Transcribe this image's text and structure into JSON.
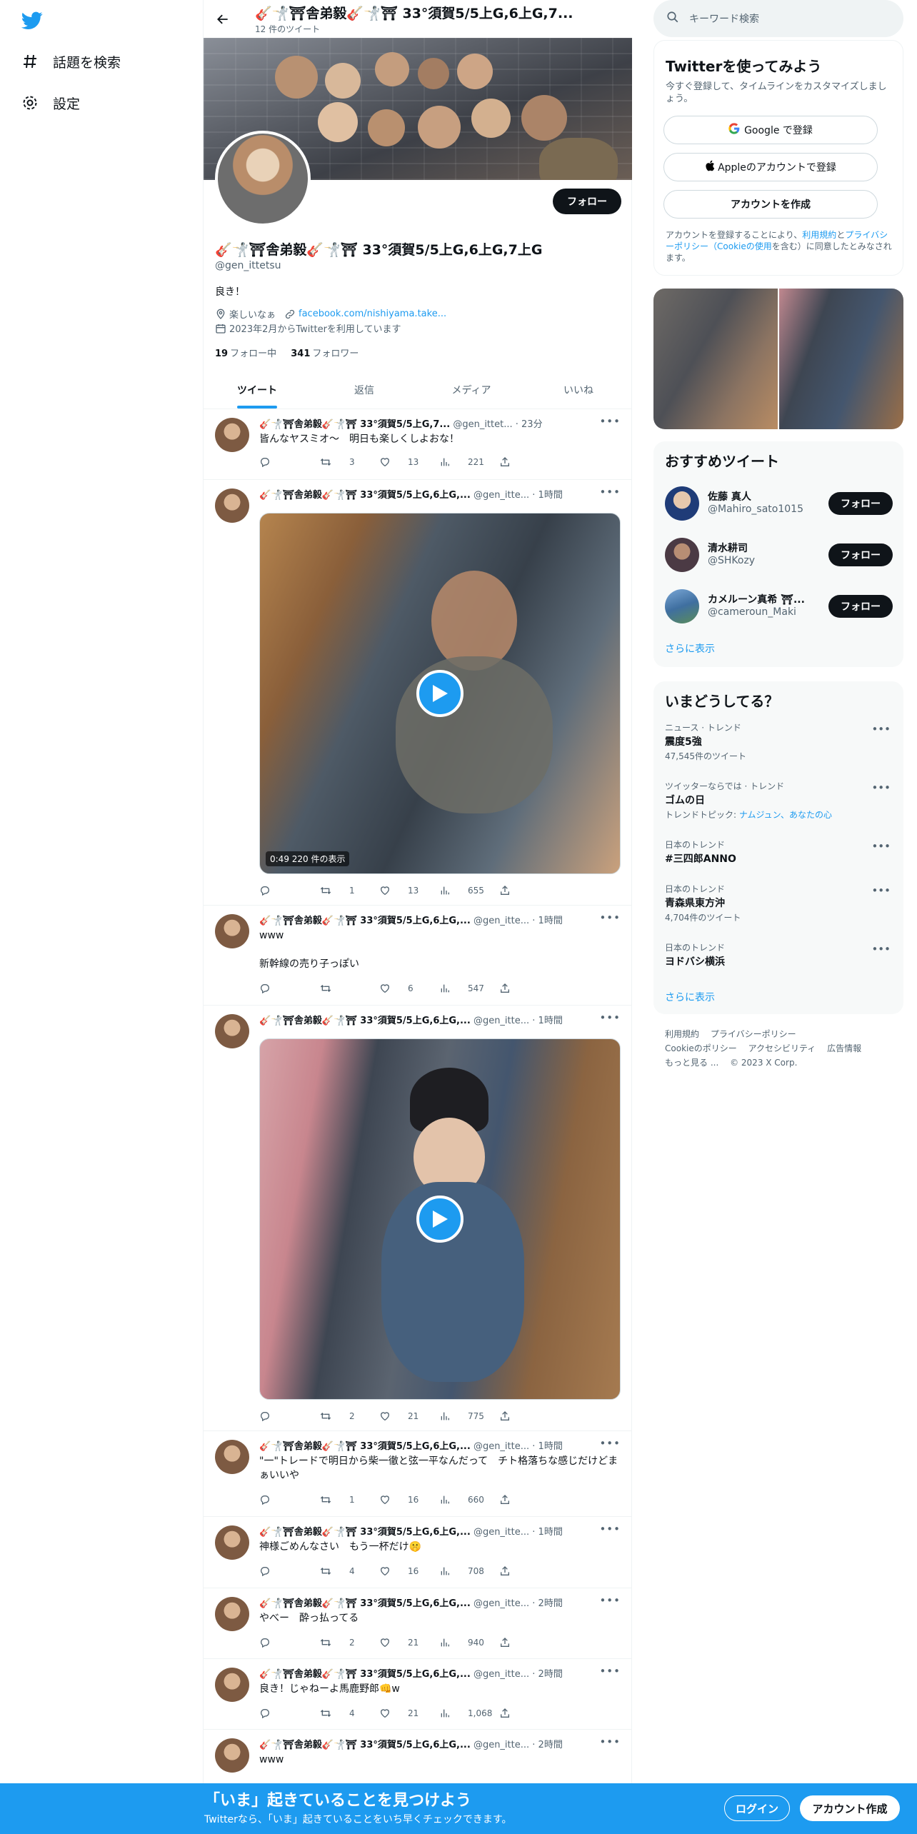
{
  "nav": {
    "explore_label": "話題を検索",
    "settings_label": "設定"
  },
  "header": {
    "name": "🎸🤺⛩舎弟毅🎸🤺⛩ 33°須賀5/5上G,6上G,7...",
    "tweet_count": "12 件のツイート"
  },
  "profile": {
    "follow_label": "フォロー",
    "name": "🎸🤺⛩舎弟毅🎸🤺⛩ 33°須賀5/5上G,6上G,7上G",
    "handle": "@gen_ittetsu",
    "bio": "良き！",
    "location": "楽しいなぁ",
    "url": "facebook.com/nishiyama.take...",
    "joined": "2023年2月からTwitterを利用しています",
    "following_count": "19",
    "following_label": "フォロー中",
    "followers_count": "341",
    "followers_label": "フォロワー"
  },
  "tabs": [
    "ツイート",
    "返信",
    "メディア",
    "いいね"
  ],
  "tweets": [
    {
      "name": "🎸🤺⛩舎弟毅🎸🤺⛩ 33°須賀5/5上G,7...",
      "handle": "@gen_ittet...",
      "time": "· 23分",
      "text": "皆んなヤスミオ〜　明日も楽しくしよおな！",
      "reply": "",
      "retweet": "3",
      "like": "13",
      "views": "221"
    },
    {
      "name": "🎸🤺⛩舎弟毅🎸🤺⛩ 33°須賀5/5上G,6上G,...",
      "handle": "@gen_itte...",
      "time": "· 1時間",
      "text": "",
      "video_info": "0:49   220 件の表示",
      "reply": "",
      "retweet": "1",
      "like": "13",
      "views": "655"
    },
    {
      "name": "🎸🤺⛩舎弟毅🎸🤺⛩ 33°須賀5/5上G,6上G,...",
      "handle": "@gen_itte...",
      "time": "· 1時間",
      "text": "www\n\n新幹線の売り子っぽい",
      "reply": "",
      "retweet": "",
      "like": "6",
      "views": "547"
    },
    {
      "name": "🎸🤺⛩舎弟毅🎸🤺⛩ 33°須賀5/5上G,6上G,...",
      "handle": "@gen_itte...",
      "time": "· 1時間",
      "text": "",
      "reply": "",
      "retweet": "2",
      "like": "21",
      "views": "775"
    },
    {
      "name": "🎸🤺⛩舎弟毅🎸🤺⛩ 33°須賀5/5上G,6上G,...",
      "handle": "@gen_itte...",
      "time": "· 1時間",
      "text": "\"一\"トレードで明日から柴一徹と弦一平なんだって　チト格落ちな感じだけどまぁいいや",
      "reply": "",
      "retweet": "1",
      "like": "16",
      "views": "660"
    },
    {
      "name": "🎸🤺⛩舎弟毅🎸🤺⛩ 33°須賀5/5上G,6上G,...",
      "handle": "@gen_itte...",
      "time": "· 1時間",
      "text": "神様ごめんなさい　もう一杯だけ🤫",
      "reply": "",
      "retweet": "4",
      "like": "16",
      "views": "708"
    },
    {
      "name": "🎸🤺⛩舎弟毅🎸🤺⛩ 33°須賀5/5上G,6上G,...",
      "handle": "@gen_itte...",
      "time": "· 2時間",
      "text": "やべー　酔っ払ってる",
      "reply": "",
      "retweet": "2",
      "like": "21",
      "views": "940"
    },
    {
      "name": "🎸🤺⛩舎弟毅🎸🤺⛩ 33°須賀5/5上G,6上G,...",
      "handle": "@gen_itte...",
      "time": "· 2時間",
      "text": "良き！じゃねーよ馬鹿野郎👊w",
      "reply": "",
      "retweet": "4",
      "like": "21",
      "views": "1,068"
    },
    {
      "name": "🎸🤺⛩舎弟毅🎸🤺⛩ 33°須賀5/5上G,6上G,...",
      "handle": "@gen_itte...",
      "time": "· 2時間",
      "text": "www"
    }
  ],
  "search": {
    "placeholder": "キーワード検索"
  },
  "signup_card": {
    "title": "Twitterを使ってみよう",
    "subtitle": "今すぐ登録して、タイムラインをカスタマイズしましょう。",
    "google_label": "Google で登録",
    "apple_label": "Appleのアカウントで登録",
    "create_label": "アカウントを作成",
    "legal_pre": "アカウントを登録することにより、",
    "legal_terms": "利用規約",
    "legal_and": "と",
    "legal_privacy": "プライバシーポリシー（Cookieの使用",
    "legal_post": "を含む）に同意したとみなされます。"
  },
  "recommended": {
    "title": "おすすめツイート",
    "users": [
      {
        "name": "佐藤 真人",
        "handle": "@Mahiro_sato1015",
        "follow_label": "フォロー"
      },
      {
        "name": "清水耕司",
        "handle": "@SHKozy",
        "follow_label": "フォロー"
      },
      {
        "name": "カメルーン真希 ⛩...",
        "handle": "@cameroun_Maki",
        "follow_label": "フォロー"
      }
    ],
    "more_label": "さらに表示"
  },
  "trends": {
    "title": "いまどうしてる？",
    "items": [
      {
        "context": "ニュース · トレンド",
        "topic": "震度5強",
        "sub": "47,545件のツイート"
      },
      {
        "context": "ツイッターならでは · トレンド",
        "topic": "ゴムの日",
        "sub": "トレンドトピック: ",
        "sub_link": "ナムジュン、あなたの心"
      },
      {
        "context": "日本のトレンド",
        "topic": "#三四郎ANNO",
        "sub": ""
      },
      {
        "context": "日本のトレンド",
        "topic": "青森県東方沖",
        "sub": "4,704件のツイート"
      },
      {
        "context": "日本のトレンド",
        "topic": "ヨドバシ横浜",
        "sub": ""
      }
    ],
    "more_label": "さらに表示"
  },
  "footer": {
    "links": [
      "利用規約",
      "プライバシーポリシー",
      "Cookieのポリシー",
      "アクセシビリティ",
      "広告情報",
      "もっと見る ...",
      "© 2023 X Corp."
    ]
  },
  "bottom_bar": {
    "title": "「いま」起きていることを見つけよう",
    "subtitle": "Twitterなら、「いま」起きていることをいち早くチェックできます。",
    "login_label": "ログイン",
    "signup_label": "アカウント作成"
  },
  "colors": {
    "accent": "#1d9bf0",
    "text": "#0f1419",
    "muted": "#536471"
  }
}
